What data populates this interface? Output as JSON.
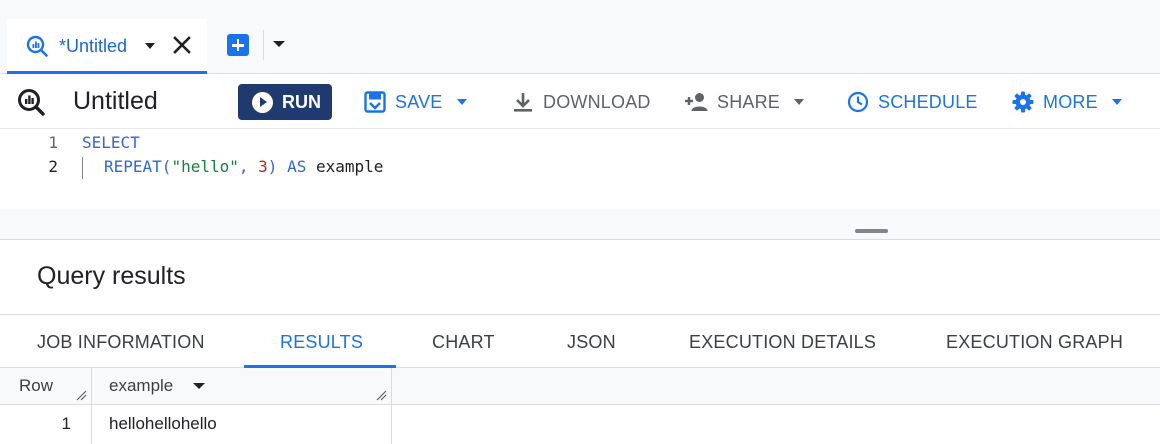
{
  "tabs": {
    "active_tab_label": "*Untitled"
  },
  "toolbar": {
    "title": "Untitled",
    "run_label": "RUN",
    "save_label": "SAVE",
    "download_label": "DOWNLOAD",
    "share_label": "SHARE",
    "schedule_label": "SCHEDULE",
    "more_label": "MORE"
  },
  "editor": {
    "line_numbers": [
      "1",
      "2"
    ],
    "line1": {
      "keyword": "SELECT"
    },
    "line2": {
      "fn": "REPEAT",
      "open_paren": "(",
      "string_arg": "\"hello\"",
      "comma": ", ",
      "number_arg": "3",
      "close_paren": ")",
      "as_kw": "AS",
      "alias": "example"
    }
  },
  "results": {
    "title": "Query results",
    "tabs": [
      "JOB INFORMATION",
      "RESULTS",
      "CHART",
      "JSON",
      "EXECUTION DETAILS",
      "EXECUTION GRAPH"
    ],
    "active_tab": "RESULTS",
    "columns": [
      "Row",
      "example"
    ],
    "rows": [
      {
        "row": "1",
        "example": "hellohellohello"
      }
    ]
  },
  "colors": {
    "accent": "#1a73e8",
    "run_button": "#1f3a6e",
    "keyword": "#3367d6",
    "string": "#188038",
    "number": "#c5221f"
  },
  "icons": {
    "tab": "query-icon",
    "close": "close-icon",
    "add": "add-tab-icon",
    "run": "play-icon",
    "save": "save-icon",
    "download": "download-icon",
    "share": "person-add-icon",
    "schedule": "clock-icon",
    "more": "gear-icon"
  }
}
